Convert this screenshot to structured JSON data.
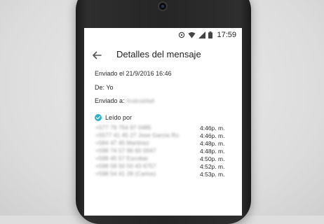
{
  "status_bar": {
    "time": "17:59",
    "icons": [
      "alarm-icon",
      "wifi-icon",
      "signal-icon",
      "battery-icon"
    ]
  },
  "toolbar": {
    "back_icon": "arrow-left-icon",
    "title": "Detalles del mensaje"
  },
  "details": {
    "sent_label": "Enviado el 21/9/2016 16:46",
    "from_label": "De: Yo",
    "sent_to_label": "Enviado a: ",
    "sent_to_value": "Android4all"
  },
  "read_by": {
    "label": "Leído por",
    "icon": "double-check-icon",
    "accent": "#2bb3c9",
    "entries": [
      {
        "name": "+577 79 754 97 0485",
        "time": "4:46p. m."
      },
      {
        "name": "+5577 41 45 27 Jose Garcia Ru",
        "time": "4:46p. m."
      },
      {
        "name": "+584 47 45 Martinez",
        "time": "4:48p. m."
      },
      {
        "name": "+598 74 57 96 60 0047",
        "time": "4:48p. m."
      },
      {
        "name": "+598 45 57 Escobar",
        "time": "4:50p. m."
      },
      {
        "name": "+598 58 50 50 43 6757",
        "time": "4:52p. m."
      },
      {
        "name": "+598 54 41 28 (Carlos)",
        "time": "4:53p. m."
      }
    ]
  }
}
